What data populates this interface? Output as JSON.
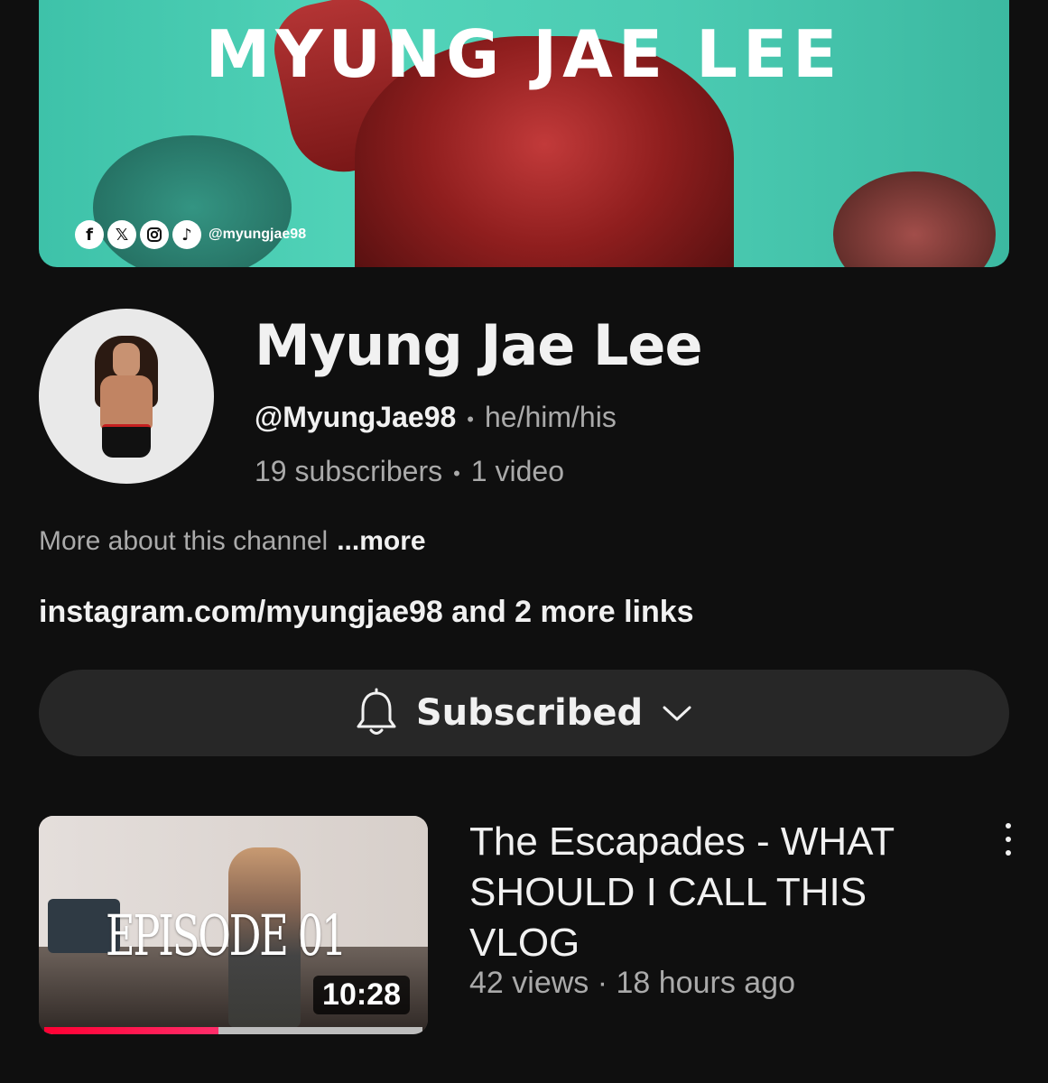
{
  "banner": {
    "title": "MYUNG JAE LEE",
    "social_icons": [
      "facebook-icon",
      "x-icon",
      "instagram-icon",
      "tiktok-icon"
    ],
    "handle": "@myungjae98"
  },
  "channel": {
    "name": "Myung Jae Lee",
    "handle": "@MyungJae98",
    "pronouns": "he/him/his",
    "subscribers": "19 subscribers",
    "video_count": "1 video",
    "about": "More about this channel",
    "about_more": "...more",
    "links": "instagram.com/myungjae98 and 2 more links"
  },
  "subscribe_button": {
    "label": "Subscribed",
    "icon": "bell-icon"
  },
  "videos": [
    {
      "thumbnail_text": "EPISODE 01",
      "duration": "10:28",
      "watch_progress": 0.46,
      "title": "The Escapades - WHAT SHOULD I CALL THIS VLOG",
      "views": "42 views",
      "age": "18 hours ago"
    }
  ],
  "colors": {
    "background": "#0f0f0f",
    "text_primary": "#f1f1f1",
    "text_secondary": "#aaaaaa",
    "button_bg": "#272727",
    "progress": "#ff0033",
    "banner_accent": "#4bcbb2"
  }
}
